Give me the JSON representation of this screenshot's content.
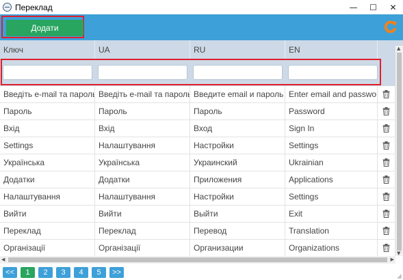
{
  "window": {
    "title": "Переклад",
    "minimize": "—",
    "maximize": "☐",
    "close": "✕"
  },
  "toolbar": {
    "add_label": "Додати",
    "refresh_icon": "refresh-icon"
  },
  "columns": [
    "Ключ",
    "UA",
    "RU",
    "EN"
  ],
  "filters": [
    {
      "value": "",
      "placeholder": ""
    },
    {
      "value": "",
      "placeholder": ""
    },
    {
      "value": "",
      "placeholder": ""
    },
    {
      "value": "",
      "placeholder": ""
    }
  ],
  "rows": [
    [
      "Введіть e-mail та пароль",
      "Введіть e-mail та пароль",
      "Введите email и пароль",
      "Enter email and password"
    ],
    [
      "Пароль",
      "Пароль",
      "Пароль",
      "Password"
    ],
    [
      "Вхід",
      "Вхід",
      "Вход",
      "Sign In"
    ],
    [
      "Settings",
      "Налаштування",
      "Настройки",
      "Settings"
    ],
    [
      "Українська",
      "Українська",
      "Украинский",
      "Ukrainian"
    ],
    [
      "Додатки",
      "Додатки",
      "Приложения",
      "Applications"
    ],
    [
      "Налаштування",
      "Налаштування",
      "Настройки",
      "Settings"
    ],
    [
      "Вийти",
      "Вийти",
      "Выйти",
      "Exit"
    ],
    [
      "Переклад",
      "Переклад",
      "Перевод",
      "Translation"
    ],
    [
      "Організації",
      "Організації",
      "Организации",
      "Organizations"
    ]
  ],
  "pagination": {
    "first": "<<",
    "pages": [
      "1",
      "2",
      "3",
      "4",
      "5"
    ],
    "active": "1",
    "last": ">>"
  },
  "colors": {
    "toolbar": "#3ea0d8",
    "add_button": "#28a55f",
    "header": "#cdd9e6",
    "highlight_frame": "#e01e2e",
    "refresh": "#f0821e"
  }
}
